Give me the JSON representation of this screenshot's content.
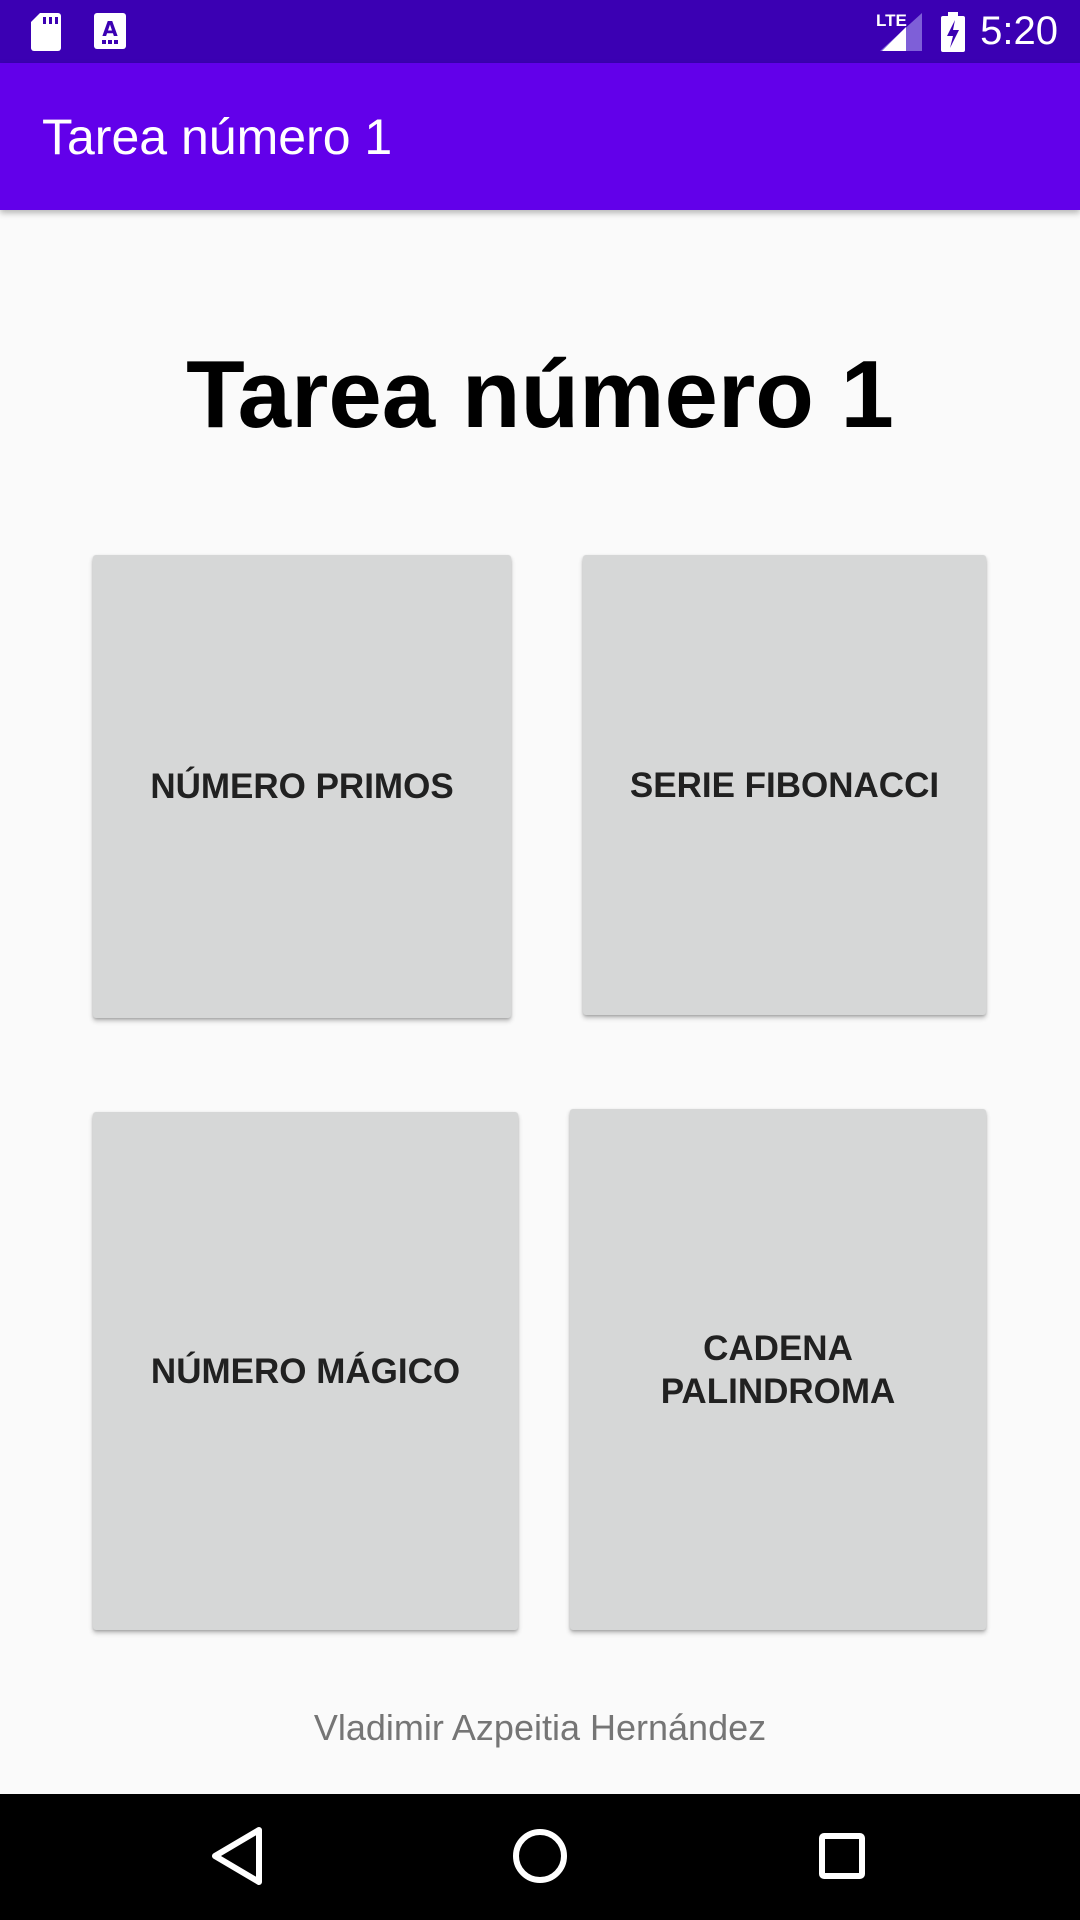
{
  "status_bar": {
    "time": "5:20",
    "network_label": "LTE",
    "icons": [
      "sd-card-icon",
      "font-app-icon",
      "signal-icon",
      "battery-charging-icon"
    ]
  },
  "app_bar": {
    "title": "Tarea número 1"
  },
  "main": {
    "title": "Tarea número 1",
    "buttons": [
      {
        "label": "NÚMERO PRIMOS"
      },
      {
        "label": "SERIE FIBONACCI"
      },
      {
        "label": "NÚMERO MÁGICO"
      },
      {
        "label_lines": [
          "CADENA",
          "PALINDROMA"
        ]
      }
    ],
    "author": "Vladimir Azpeitia Hernández"
  },
  "nav_bar": {
    "icons": [
      "back-icon",
      "home-icon",
      "recents-icon"
    ]
  },
  "colors": {
    "status_bar": "#3b00b3",
    "app_bar": "#6200ea",
    "background": "#fafafa",
    "tile": "#d6d7d7"
  }
}
